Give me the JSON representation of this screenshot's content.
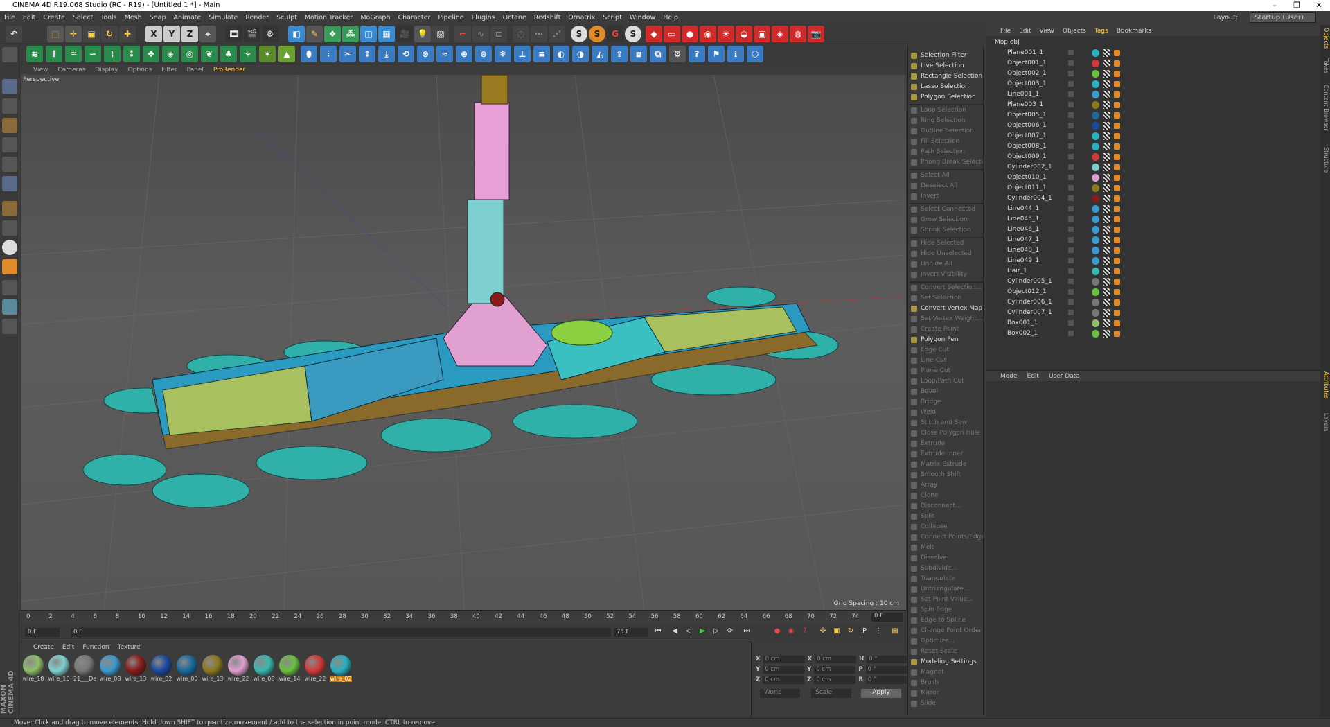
{
  "window": {
    "title": "CINEMA 4D R19.068 Studio (RC - R19) - [Untitled 1 *] - Main",
    "min": "–",
    "max": "❐",
    "close": "✕"
  },
  "menubar": {
    "items": [
      "File",
      "Edit",
      "Create",
      "Select",
      "Tools",
      "Mesh",
      "Snap",
      "Animate",
      "Simulate",
      "Render",
      "Sculpt",
      "Motion Tracker",
      "MoGraph",
      "Character",
      "Pipeline",
      "Plugins",
      "Octane",
      "Redshift",
      "Ornatrix",
      "Script",
      "Window",
      "Help"
    ],
    "layout_label": "Layout:",
    "layout_value": "Startup (User)"
  },
  "viewport_menu": {
    "items": [
      "View",
      "Cameras",
      "Display",
      "Options",
      "Filter",
      "Panel"
    ],
    "prorender": "ProRender"
  },
  "viewport": {
    "name": "Perspective",
    "grid_spacing": "Grid Spacing : 10 cm"
  },
  "timeline": {
    "ticks": [
      "0",
      "2",
      "4",
      "6",
      "8",
      "10",
      "12",
      "14",
      "16",
      "18",
      "20",
      "22",
      "24",
      "26",
      "28",
      "30",
      "32",
      "34",
      "36",
      "38",
      "40",
      "42",
      "44",
      "46",
      "48",
      "50",
      "52",
      "54",
      "56",
      "58",
      "60",
      "62",
      "64",
      "66",
      "68",
      "70",
      "72",
      "74"
    ],
    "current_frame": "0 F"
  },
  "transport": {
    "start": "0 F",
    "range_start": "0 F",
    "range_end": "75 F",
    "end": "75 F"
  },
  "materials": {
    "menu": [
      "Create",
      "Edit",
      "Function",
      "Texture"
    ],
    "items": [
      {
        "label": "wire_18",
        "color": "#8fbf6a"
      },
      {
        "label": "wire_16",
        "color": "#7fd0d0"
      },
      {
        "label": "21___De",
        "color": "#777777"
      },
      {
        "label": "wire_08",
        "color": "#3a9ad0"
      },
      {
        "label": "wire_13",
        "color": "#8a1a1a"
      },
      {
        "label": "wire_02",
        "color": "#1a4aa0"
      },
      {
        "label": "wire_00",
        "color": "#1a6aa0"
      },
      {
        "label": "wire_13",
        "color": "#8a7a20"
      },
      {
        "label": "wire_22",
        "color": "#e0a0d0"
      },
      {
        "label": "wire_08",
        "color": "#3ab8b0"
      },
      {
        "label": "wire_14",
        "color": "#6ac040"
      },
      {
        "label": "wire_22",
        "color": "#d03a3a"
      },
      {
        "label": "wire_02",
        "color": "#2ab0c0"
      }
    ]
  },
  "coords": {
    "x": "X",
    "y": "Y",
    "z": "Z",
    "px": "0 cm",
    "py": "0 cm",
    "pz": "0 cm",
    "sx": "0 cm",
    "sy": "0 cm",
    "sz": "0 cm",
    "h": "H",
    "p": "P",
    "b": "B",
    "rh": "0 °",
    "rp": "0 °",
    "rb": "0 °",
    "world": "World",
    "scale": "Scale",
    "apply": "Apply"
  },
  "status": "Move: Click and drag to move elements. Hold down SHIFT to quantize movement / add to the selection in point mode, CTRL to remove.",
  "maxon": "MAXON CINEMA 4D",
  "commands": [
    {
      "label": "Selection Filter",
      "on": true
    },
    {
      "label": "Live Selection",
      "on": true
    },
    {
      "label": "Rectangle Selection",
      "on": true
    },
    {
      "label": "Lasso Selection",
      "on": true
    },
    {
      "label": "Polygon Selection",
      "on": true
    },
    {
      "label": "Loop Selection",
      "on": false,
      "sep": true
    },
    {
      "label": "Ring Selection",
      "on": false
    },
    {
      "label": "Outline Selection",
      "on": false
    },
    {
      "label": "Fill Selection",
      "on": false
    },
    {
      "label": "Path Selection",
      "on": false
    },
    {
      "label": "Phong Break Selection",
      "on": false
    },
    {
      "label": "Select All",
      "on": false,
      "sep": true
    },
    {
      "label": "Deselect All",
      "on": false
    },
    {
      "label": "Invert",
      "on": false
    },
    {
      "label": "Select Connected",
      "on": false,
      "sep": true
    },
    {
      "label": "Grow Selection",
      "on": false
    },
    {
      "label": "Shrink Selection",
      "on": false
    },
    {
      "label": "Hide Selected",
      "on": false,
      "sep": true
    },
    {
      "label": "Hide Unselected",
      "on": false
    },
    {
      "label": "Unhide All",
      "on": false
    },
    {
      "label": "Invert Visibility",
      "on": false
    },
    {
      "label": "Convert Selection...",
      "on": false,
      "sep": true
    },
    {
      "label": "Set Selection",
      "on": false
    },
    {
      "label": "Convert Vertex Map...",
      "on": true
    },
    {
      "label": "Set Vertex Weight...",
      "on": false
    },
    {
      "label": "Create Point",
      "on": false
    },
    {
      "label": "Polygon Pen",
      "on": true
    },
    {
      "label": "Edge Cut",
      "on": false
    },
    {
      "label": "Line Cut",
      "on": false
    },
    {
      "label": "Plane Cut",
      "on": false
    },
    {
      "label": "Loop/Path Cut",
      "on": false
    },
    {
      "label": "Bevel",
      "on": false
    },
    {
      "label": "Bridge",
      "on": false
    },
    {
      "label": "Weld",
      "on": false
    },
    {
      "label": "Stitch and Sew",
      "on": false
    },
    {
      "label": "Close Polygon Hole",
      "on": false
    },
    {
      "label": "Extrude",
      "on": false
    },
    {
      "label": "Extrude Inner",
      "on": false
    },
    {
      "label": "Matrix Extrude",
      "on": false
    },
    {
      "label": "Smooth Shift",
      "on": false
    },
    {
      "label": "Array",
      "on": false
    },
    {
      "label": "Clone",
      "on": false
    },
    {
      "label": "Disconnect...",
      "on": false
    },
    {
      "label": "Split",
      "on": false
    },
    {
      "label": "Collapse",
      "on": false
    },
    {
      "label": "Connect Points/Edges",
      "on": false
    },
    {
      "label": "Melt",
      "on": false
    },
    {
      "label": "Dissolve",
      "on": false
    },
    {
      "label": "Subdivide...",
      "on": false
    },
    {
      "label": "Triangulate",
      "on": false
    },
    {
      "label": "Untriangulate...",
      "on": false
    },
    {
      "label": "Set Point Value...",
      "on": false
    },
    {
      "label": "Spin Edge",
      "on": false
    },
    {
      "label": "Edge to Spline",
      "on": false
    },
    {
      "label": "Change Point Order",
      "on": false
    },
    {
      "label": "Optimize...",
      "on": false
    },
    {
      "label": "Reset Scale",
      "on": false
    },
    {
      "label": "Modeling Settings",
      "on": true
    },
    {
      "label": "Magnet",
      "on": false
    },
    {
      "label": "Brush",
      "on": false
    },
    {
      "label": "Mirror",
      "on": false
    },
    {
      "label": "Slide",
      "on": false
    }
  ],
  "objects": {
    "menu": [
      "File",
      "Edit",
      "View",
      "Objects",
      "Tags",
      "Bookmarks"
    ],
    "root": "Mop.obj",
    "rows": [
      {
        "name": "Plane001_1",
        "color": "#2ab0c0"
      },
      {
        "name": "Object001_1",
        "color": "#d03a3a"
      },
      {
        "name": "Object002_1",
        "color": "#6ac040"
      },
      {
        "name": "Object003_1",
        "color": "#2ab0c0"
      },
      {
        "name": "Line001_1",
        "color": "#3a9ad0"
      },
      {
        "name": "Plane003_1",
        "color": "#8a7a20"
      },
      {
        "name": "Object005_1",
        "color": "#1a6aa0"
      },
      {
        "name": "Object006_1",
        "color": "#1a4aa0"
      },
      {
        "name": "Object007_1",
        "color": "#2ab0c0"
      },
      {
        "name": "Object008_1",
        "color": "#2ab0c0"
      },
      {
        "name": "Object009_1",
        "color": "#d03a3a"
      },
      {
        "name": "Cylinder002_1",
        "color": "#7fd0d0"
      },
      {
        "name": "Object010_1",
        "color": "#e0a0d0"
      },
      {
        "name": "Object011_1",
        "color": "#8a7a20"
      },
      {
        "name": "Cylinder004_1",
        "color": "#8a1a1a"
      },
      {
        "name": "Line044_1",
        "color": "#3a9ad0"
      },
      {
        "name": "Line045_1",
        "color": "#3a9ad0"
      },
      {
        "name": "Line046_1",
        "color": "#3a9ad0"
      },
      {
        "name": "Line047_1",
        "color": "#3a9ad0"
      },
      {
        "name": "Line048_1",
        "color": "#3a9ad0"
      },
      {
        "name": "Line049_1",
        "color": "#3a9ad0"
      },
      {
        "name": "Hair_1",
        "color": "#3ab8b0"
      },
      {
        "name": "Cylinder005_1",
        "color": "#777777"
      },
      {
        "name": "Object012_1",
        "color": "#6ac040"
      },
      {
        "name": "Cylinder006_1",
        "color": "#777777"
      },
      {
        "name": "Cylinder007_1",
        "color": "#777777"
      },
      {
        "name": "Box001_1",
        "color": "#8fbf6a"
      },
      {
        "name": "Box002_1",
        "color": "#6ac040"
      }
    ]
  },
  "attributes": {
    "menu": [
      "Mode",
      "Edit",
      "User Data"
    ]
  },
  "side_tabs": [
    "Objects",
    "Takes",
    "Content Browser",
    "Structure",
    "Attributes",
    "Layers"
  ]
}
